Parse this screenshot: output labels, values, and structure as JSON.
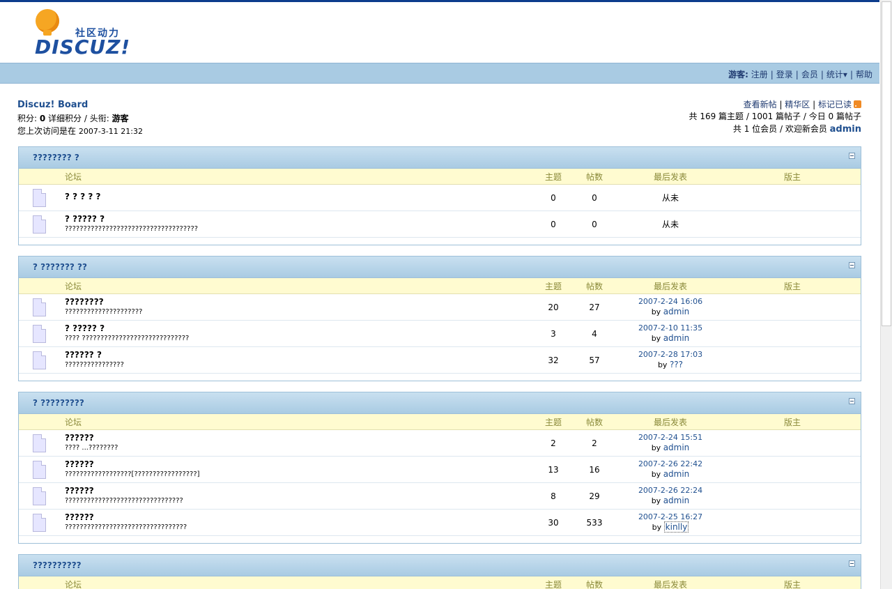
{
  "logo": {
    "cn": "社区动力",
    "en": "DISCUZ!"
  },
  "nav": {
    "guest_label": "游客:",
    "items": [
      "注册",
      "登录",
      "会员",
      "统计▾",
      "帮助"
    ]
  },
  "board": {
    "title": "Discuz! Board",
    "credit_label": "积分: ",
    "credit_value": "0",
    "credit_rest": " 详细积分 / 头衔: ",
    "rank": "游客",
    "lastvisit_label": "您上次访问是在 ",
    "lastvisit_value": "2007-3-11 21:32"
  },
  "toplinks": {
    "new_posts": "查看新帖",
    "digest": "精华区",
    "mark_read": "标记已读"
  },
  "stats": {
    "line1": "共 169 篇主题 / 1001 篇帖子 / 今日 0 篇帖子",
    "line2_prefix": "共 1 位会员 / 欢迎新会员 ",
    "new_member": "admin"
  },
  "columns": {
    "forum": "论坛",
    "topics": "主题",
    "posts": "帖数",
    "lastpost": "最后发表",
    "moderator": "版主"
  },
  "categories": [
    {
      "title": "???????? ?",
      "forums": [
        {
          "name": "? ? ? ? ?",
          "desc": "",
          "topics": "0",
          "posts": "0",
          "never": "从未"
        },
        {
          "name": "? ????? ?",
          "desc": "????????????????????????????????????",
          "topics": "0",
          "posts": "0",
          "never": "从未"
        }
      ]
    },
    {
      "title": "? ??????? ??",
      "forums": [
        {
          "name": "????????",
          "desc": "?????????????????????",
          "topics": "20",
          "posts": "27",
          "date": "2007-2-24 16:06",
          "by": "by ",
          "user": "admin"
        },
        {
          "name": "? ????? ?",
          "desc": "???? ?????????????????????????????",
          "topics": "3",
          "posts": "4",
          "date": "2007-2-10 11:35",
          "by": "by ",
          "user": "admin"
        },
        {
          "name": "?????? ?",
          "desc": "????????????????",
          "topics": "32",
          "posts": "57",
          "date": "2007-2-28 17:03",
          "by": "by ",
          "user": "???"
        }
      ]
    },
    {
      "title": "? ?????????",
      "forums": [
        {
          "name": "??????",
          "desc": "???? ...????????",
          "topics": "2",
          "posts": "2",
          "date": "2007-2-24 15:51",
          "by": "by ",
          "user": "admin"
        },
        {
          "name": "??????",
          "desc": "??????????????????[?????????????????]",
          "topics": "13",
          "posts": "16",
          "date": "2007-2-26 22:42",
          "by": "by ",
          "user": "admin"
        },
        {
          "name": "??????",
          "desc": "????????????????????????????????",
          "topics": "8",
          "posts": "29",
          "date": "2007-2-26 22:24",
          "by": "by ",
          "user": "admin"
        },
        {
          "name": "??????",
          "desc": "?????????????????????????????????",
          "topics": "30",
          "posts": "533",
          "date": "2007-2-25 16:27",
          "by": "by ",
          "user": "kinlly"
        }
      ]
    },
    {
      "title": "??????????",
      "forums": []
    }
  ]
}
